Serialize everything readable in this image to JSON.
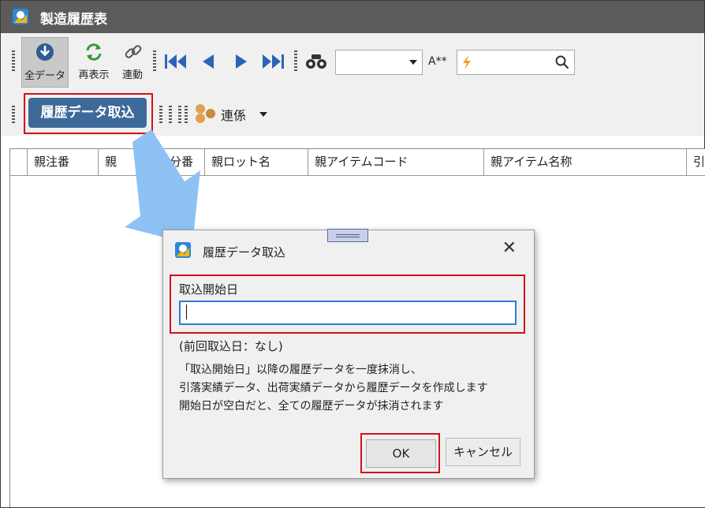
{
  "window": {
    "title": "製造履歴表"
  },
  "toolbar": {
    "all_data_label": "全データ",
    "redisplay_label": "再表示",
    "link_label": "連動",
    "font_size_label": "A**",
    "import_button_label": "履歴データ取込",
    "renkei_label": "連係"
  },
  "grid": {
    "columns": [
      "",
      "親注番",
      "親",
      "親分番",
      "親ロット名",
      "親アイテムコード",
      "親アイテム名称",
      "引"
    ]
  },
  "dialog": {
    "title": "履歴データ取込",
    "field_label": "取込開始日",
    "field_value": "",
    "previous_info": "(前回取込日：なし)",
    "description_lines": [
      "「取込開始日」以降の履歴データを一度抹消し、",
      "引落実績データ、出荷実績データから履歴データを作成します",
      "開始日が空白だと、全ての履歴データが抹消されます"
    ],
    "ok_label": "OK",
    "cancel_label": "キャンセル"
  },
  "colors": {
    "titlebar": "#5b5b5b",
    "import_button": "#3e6a9a",
    "highlight": "#d0121b",
    "arrow": "#8ec2f5",
    "input_focus": "#2b7cd3"
  }
}
